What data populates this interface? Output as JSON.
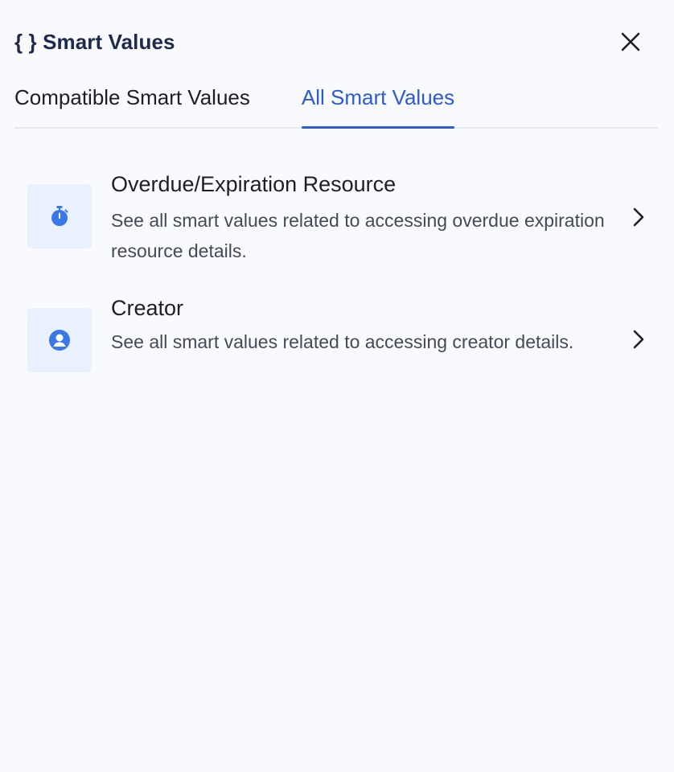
{
  "header": {
    "braces_icon": "curly-braces-icon",
    "title": "{ } Smart Values",
    "close_icon": "close-icon"
  },
  "tabs": [
    {
      "label": "Compatible Smart Values",
      "active": false
    },
    {
      "label": "All Smart Values",
      "active": true
    }
  ],
  "items": [
    {
      "icon": "stopwatch-icon",
      "title": "Overdue/Expiration Resource",
      "description": "See all smart values related to accessing overdue expiration resource details.",
      "chevron_icon": "chevron-right-icon"
    },
    {
      "icon": "user-circle-icon",
      "title": "Creator",
      "description": "See all smart values related to accessing creator details.",
      "chevron_icon": "chevron-right-icon"
    }
  ],
  "colors": {
    "accent": "#2c5ad6",
    "title": "#1d2a4d",
    "icon_bg": "#e8f1fd",
    "icon_fg": "#3a78e8",
    "background": "#f9fafd"
  }
}
